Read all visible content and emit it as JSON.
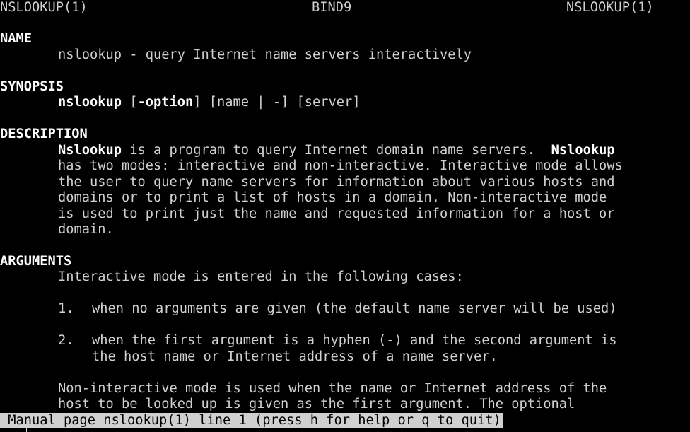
{
  "header": {
    "left": "NSLOOKUP(1)",
    "center": "BIND9",
    "right": "NSLOOKUP(1)"
  },
  "name_section": {
    "heading": "NAME",
    "text": "nslookup - query Internet name servers interactively"
  },
  "synopsis_section": {
    "heading": "SYNOPSIS",
    "cmd": "nslookup",
    "open_bracket": " [",
    "option": "-option",
    "rest": "] [name | -] [server]"
  },
  "description_section": {
    "heading": "DESCRIPTION",
    "line1_bold_a": "Nslookup",
    "line1_text": " is a program to query Internet domain name servers.  ",
    "line1_bold_b": "Nslookup",
    "lines": [
      "has two modes: interactive and non-interactive. Interactive mode allows",
      "the user to query name servers for information about various hosts and",
      "domains or to print a list of hosts in a domain. Non-interactive mode",
      "is used to print just the name and requested information for a host or",
      "domain."
    ]
  },
  "arguments_section": {
    "heading": "ARGUMENTS",
    "intro": "Interactive mode is entered in the following cases:",
    "item1_num": "1.",
    "item1_text": "when no arguments are given (the default name server will be used)",
    "item2_num": "2.",
    "item2_line1": "when the first argument is a hyphen (-) and the second argument is",
    "item2_line2": "the host name or Internet address of a name server.",
    "para_line1": "Non-interactive mode is used when the name or Internet address of the",
    "para_line2": "host to be looked up is given as the first argument. The optional"
  },
  "status": {
    "text": " Manual page nslookup(1) line 1 (press h for help or q to quit)"
  },
  "colors": {
    "background": "#000000",
    "foreground": "#d0d0d0",
    "bold": "#ffffff",
    "statusbar_bg": "#d0d0d0",
    "statusbar_fg": "#000000"
  }
}
